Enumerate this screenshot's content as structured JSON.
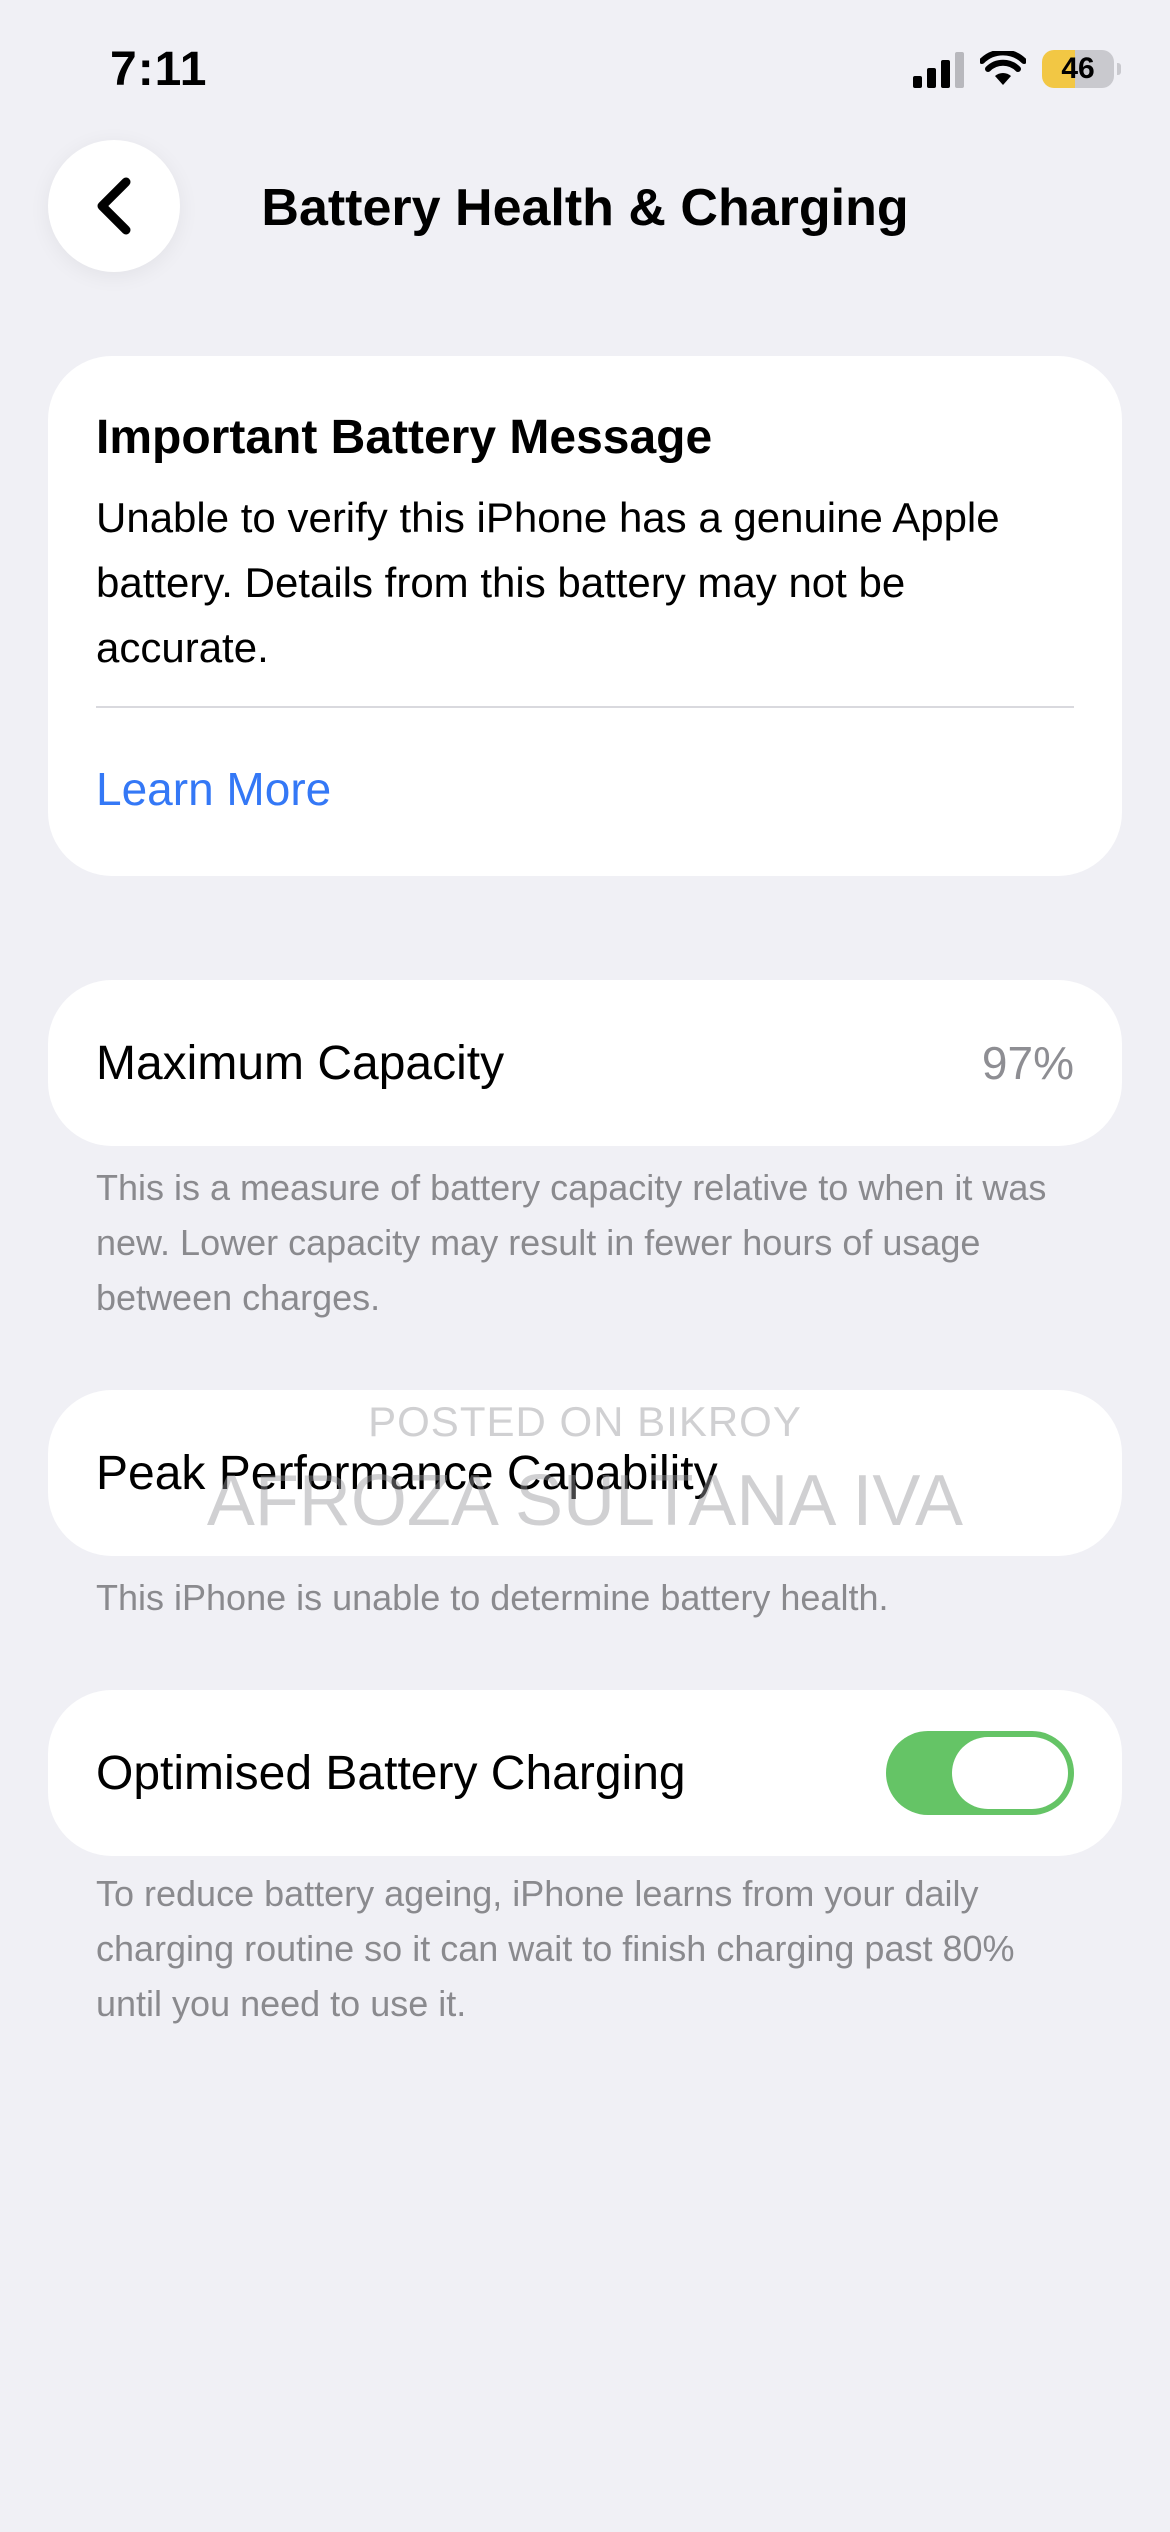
{
  "status_bar": {
    "time": "7:11",
    "battery_level": "46",
    "battery_color": "#f2c744",
    "icons": [
      "cellular-signal-icon",
      "wifi-icon",
      "battery-icon"
    ]
  },
  "nav": {
    "back_icon": "chevron-left-icon",
    "title": "Battery Health & Charging"
  },
  "message_card": {
    "title": "Important Battery Message",
    "body": "Unable to verify this iPhone has a genuine Apple battery. Details from this battery may not be accurate.",
    "link": "Learn More",
    "link_color": "#3478f6"
  },
  "maximum_capacity": {
    "label": "Maximum Capacity",
    "value": "97%",
    "footnote": "This is a measure of battery capacity relative to when it was new. Lower capacity may result in fewer hours of usage between charges."
  },
  "peak_performance": {
    "label": "Peak Performance Capability",
    "footnote": "This iPhone is unable to determine battery health."
  },
  "optimised_charging": {
    "label": "Optimised Battery Charging",
    "enabled": true,
    "toggle_color": "#65c466",
    "footnote": "To reduce battery ageing, iPhone learns from your daily charging routine so it can wait to finish charging past 80% until you need to use it."
  },
  "watermark": {
    "line1": "POSTED ON BIKROY",
    "line2": "AFROZA SULTANA IVA"
  }
}
